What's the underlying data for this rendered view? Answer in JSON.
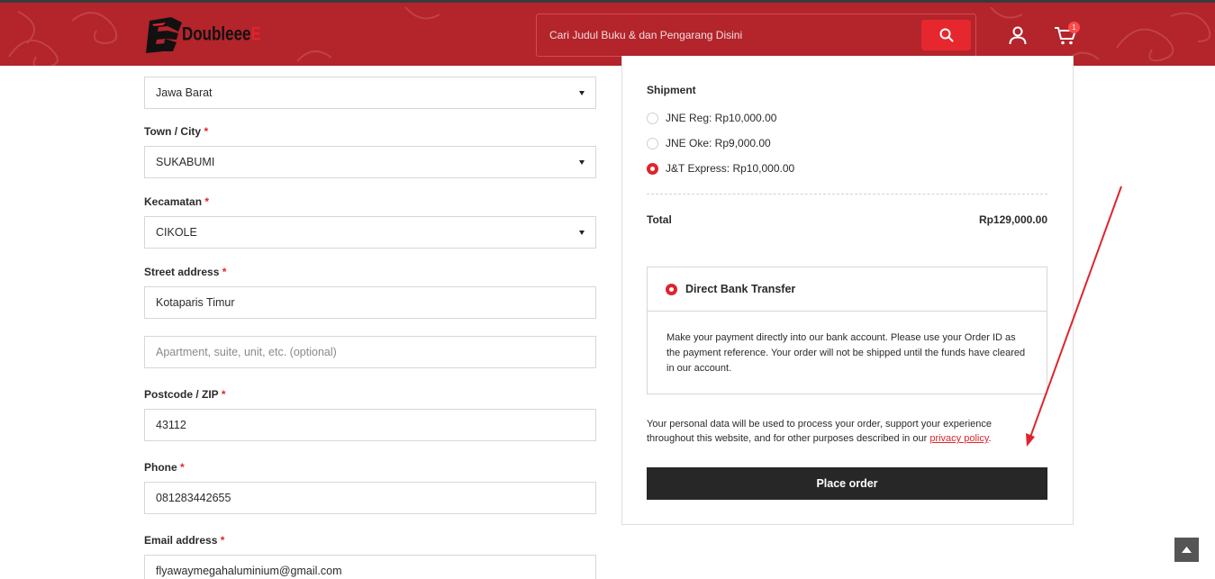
{
  "header": {
    "logo_text": "Doubleee",
    "logo_suffix": "E",
    "search_placeholder": "Cari Judul Buku & dan Pengarang Disini",
    "cart_count": "1",
    "brand_color": "#b3242b",
    "accent_color": "#e7272e"
  },
  "form": {
    "state_value": "Jawa Barat",
    "city": {
      "label": "Town / City",
      "required": "*",
      "value": "SUKABUMI"
    },
    "district": {
      "label": "Kecamatan",
      "required": "*",
      "value": "CIKOLE"
    },
    "street": {
      "label": "Street address",
      "required": "*",
      "value": "Kotaparis Timur",
      "placeholder2": "Apartment, suite, unit, etc. (optional)"
    },
    "postcode": {
      "label": "Postcode / ZIP",
      "required": "*",
      "value": "43112"
    },
    "phone": {
      "label": "Phone",
      "required": "*",
      "value": "081283442655"
    },
    "email": {
      "label": "Email address",
      "required": "*",
      "value": "flyawaymegahaluminium@gmail.com"
    }
  },
  "order": {
    "shipment_title": "Shipment",
    "shipping_options": [
      {
        "label": "JNE Reg: Rp10,000.00",
        "selected": false
      },
      {
        "label": "JNE Oke: Rp9,000.00",
        "selected": false
      },
      {
        "label": "J&T Express: Rp10,000.00",
        "selected": true
      }
    ],
    "total_label": "Total",
    "total_value": "Rp129,000.00",
    "payment": {
      "method": "Direct Bank Transfer",
      "description": "Make your payment directly into our bank account. Please use your Order ID as the payment reference. Your order will not be shipped until the funds have cleared in our account."
    },
    "privacy_text": "Your personal data will be used to process your order, support your experience throughout this website, and for other purposes described in our ",
    "privacy_link": "privacy policy",
    "privacy_end": ".",
    "place_order_label": "Place order"
  }
}
